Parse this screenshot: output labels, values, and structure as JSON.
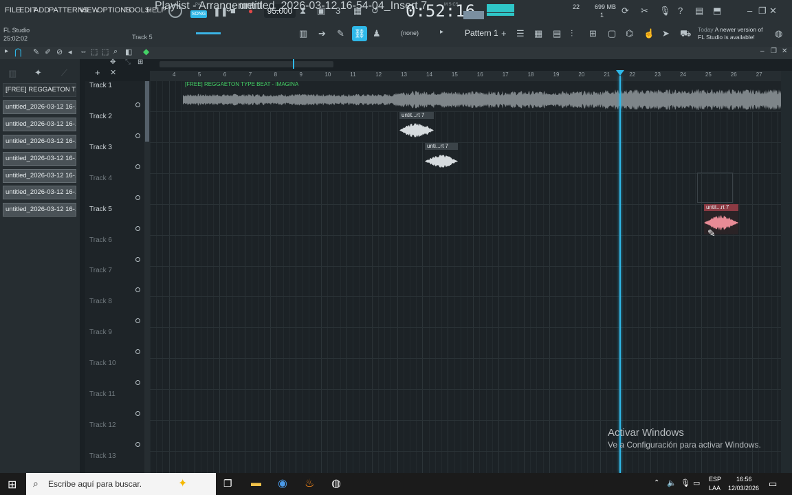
{
  "menu": [
    "FILE",
    "EDIT",
    "ADD",
    "PATTERNS",
    "VIEW",
    "OPTIONS",
    "TOOLS",
    "HELP"
  ],
  "transport": {
    "pat_label": "PAT",
    "song_label": "SONG",
    "tempo": "95.000",
    "time": "0:52:16",
    "time_unit": "M:S:CS"
  },
  "pattern": {
    "name": "Pattern 1",
    "none": "(none)"
  },
  "status": {
    "cpu": "22",
    "memory": "699 MB",
    "poly": "1",
    "notice_day": "Today",
    "notice_text": "A newer version of FL Studio is available!"
  },
  "info": {
    "app": "FL Studio",
    "time": "25:02:02",
    "track": "Track 5"
  },
  "breadcrumb": {
    "title": "Playlist - Arrangement",
    "file": "untitled_2026-03-12 16-54-04_Insert 7"
  },
  "browser_items": [
    "[FREE] REGGAETON T...",
    "untitled_2026-03-12 16-...",
    "untitled_2026-03-12 16-...",
    "untitled_2026-03-12 16-...",
    "untitled_2026-03-12 16-...",
    "untitled_2026-03-12 16-...",
    "untitled_2026-03-12 16-...",
    "untitled_2026-03-12 16-..."
  ],
  "ruler": [
    "4",
    "5",
    "6",
    "7",
    "8",
    "9",
    "10",
    "11",
    "12",
    "13",
    "14",
    "15",
    "16",
    "17",
    "18",
    "19",
    "20",
    "21",
    "22",
    "23",
    "24",
    "25",
    "26",
    "27"
  ],
  "tracks": [
    "Track 1",
    "Track 2",
    "Track 3",
    "Track 4",
    "Track 5",
    "Track 6",
    "Track 7",
    "Track 8",
    "Track 9",
    "Track 10",
    "Track 11",
    "Track 12",
    "Track 13"
  ],
  "clips": {
    "main": "[FREE] REGGAETON TYPE BEAT - IMAGINA",
    "c2": "untit...rt 7",
    "c3": "unti...rt 7",
    "c5": "untit...rt 7"
  },
  "watermark": {
    "title": "Activar Windows",
    "sub": "Ve a Configuración para activar Windows."
  },
  "taskbar": {
    "search": "Escribe aquí para buscar.",
    "lang1": "ESP",
    "lang2": "LAA",
    "time": "16:56",
    "date": "12/03/2026"
  },
  "colors": {
    "accent": "#2fb8e8",
    "clip_green": "#44d266",
    "clip_red": "#c9545e"
  }
}
